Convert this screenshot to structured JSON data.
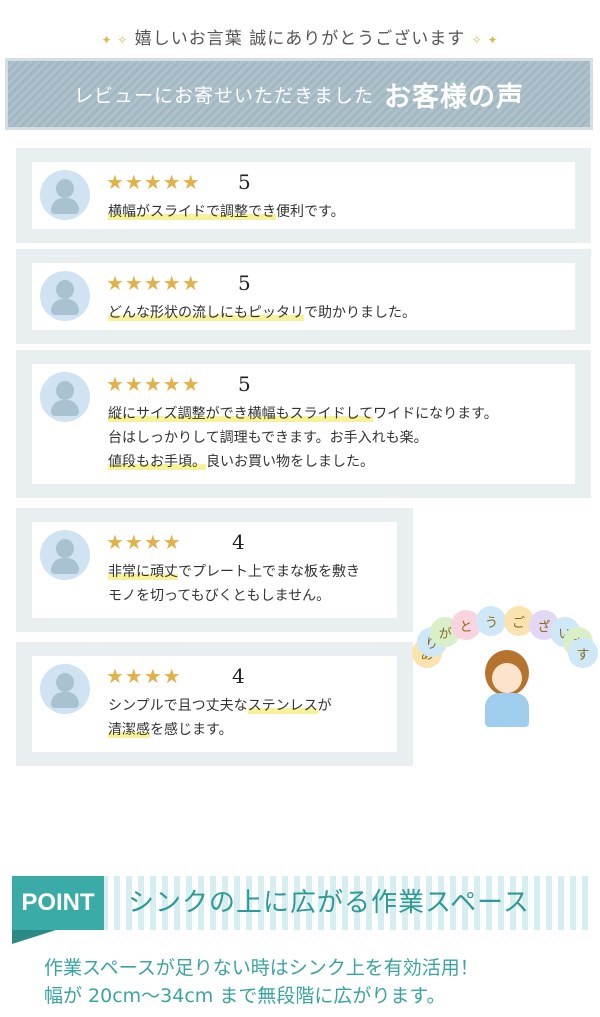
{
  "header": {
    "tagline": "嬉しいお言葉 誠にありがとうございます",
    "banner_small": "レビューにお寄せいただきました",
    "banner_big": "お客様の声"
  },
  "reviews": [
    {
      "stars": "★★★★★",
      "rating": "5",
      "lines": [
        {
          "segments": [
            {
              "t": "横幅がスライドで調整でき",
              "hl": true
            },
            {
              "t": "便利です。",
              "hl": false
            }
          ]
        }
      ]
    },
    {
      "stars": "★★★★★",
      "rating": "5",
      "lines": [
        {
          "segments": [
            {
              "t": "どんな形状の流しにもピッタリ",
              "hl": true
            },
            {
              "t": "で助かりました。",
              "hl": false
            }
          ]
        }
      ]
    },
    {
      "stars": "★★★★★",
      "rating": "5",
      "lines": [
        {
          "segments": [
            {
              "t": "縦にサイズ調整ができ横幅もスライドして",
              "hl": true
            },
            {
              "t": "ワイドになります。",
              "hl": false
            }
          ]
        },
        {
          "segments": [
            {
              "t": "台はしっかりして調理もできます。お手入れも楽。",
              "hl": false
            }
          ]
        },
        {
          "segments": [
            {
              "t": "値段もお手頃。",
              "hl": true
            },
            {
              "t": "良いお買い物をしました。",
              "hl": false
            }
          ]
        }
      ]
    },
    {
      "stars": "★★★★",
      "rating": "4",
      "lines": [
        {
          "segments": [
            {
              "t": "非常に頑丈",
              "hl": true
            },
            {
              "t": "でプレート上でまな板を敷き",
              "hl": false
            }
          ]
        },
        {
          "segments": [
            {
              "t": "モノを切ってもびくともしません。",
              "hl": false
            }
          ]
        }
      ]
    },
    {
      "stars": "★★★★",
      "rating": "4",
      "lines": [
        {
          "segments": [
            {
              "t": "シンプルで且つ丈夫な",
              "hl": false
            },
            {
              "t": "ステンレス",
              "hl": true
            },
            {
              "t": "が",
              "hl": false
            }
          ]
        },
        {
          "segments": [
            {
              "t": "清潔感",
              "hl": true
            },
            {
              "t": "を感じます。",
              "hl": false
            }
          ]
        }
      ]
    }
  ],
  "illustration": {
    "bubble_chars": [
      "あ",
      "り",
      "が",
      "と",
      "う",
      "ご",
      "ざ",
      "い",
      "ま",
      "す"
    ],
    "bubble_colors": [
      "#fbe3b0",
      "#cfe8f8",
      "#d9efc8",
      "#f9d4e0",
      "#cfe8f8",
      "#fbe3b0",
      "#e2d8f3",
      "#cfe8f8",
      "#d9efc8",
      "#cfe8f8"
    ]
  },
  "point": {
    "label": "POINT",
    "title": "シンクの上に広がる作業スペース",
    "desc_line1": "作業スペースが足りない時はシンク上を有効活用！",
    "desc_line2": "幅が 20cm〜34cm まで無段階に広がります。"
  },
  "colors": {
    "accent": "#3aaba6",
    "star": "#e2b24a",
    "highlight": "#f7f29a"
  }
}
